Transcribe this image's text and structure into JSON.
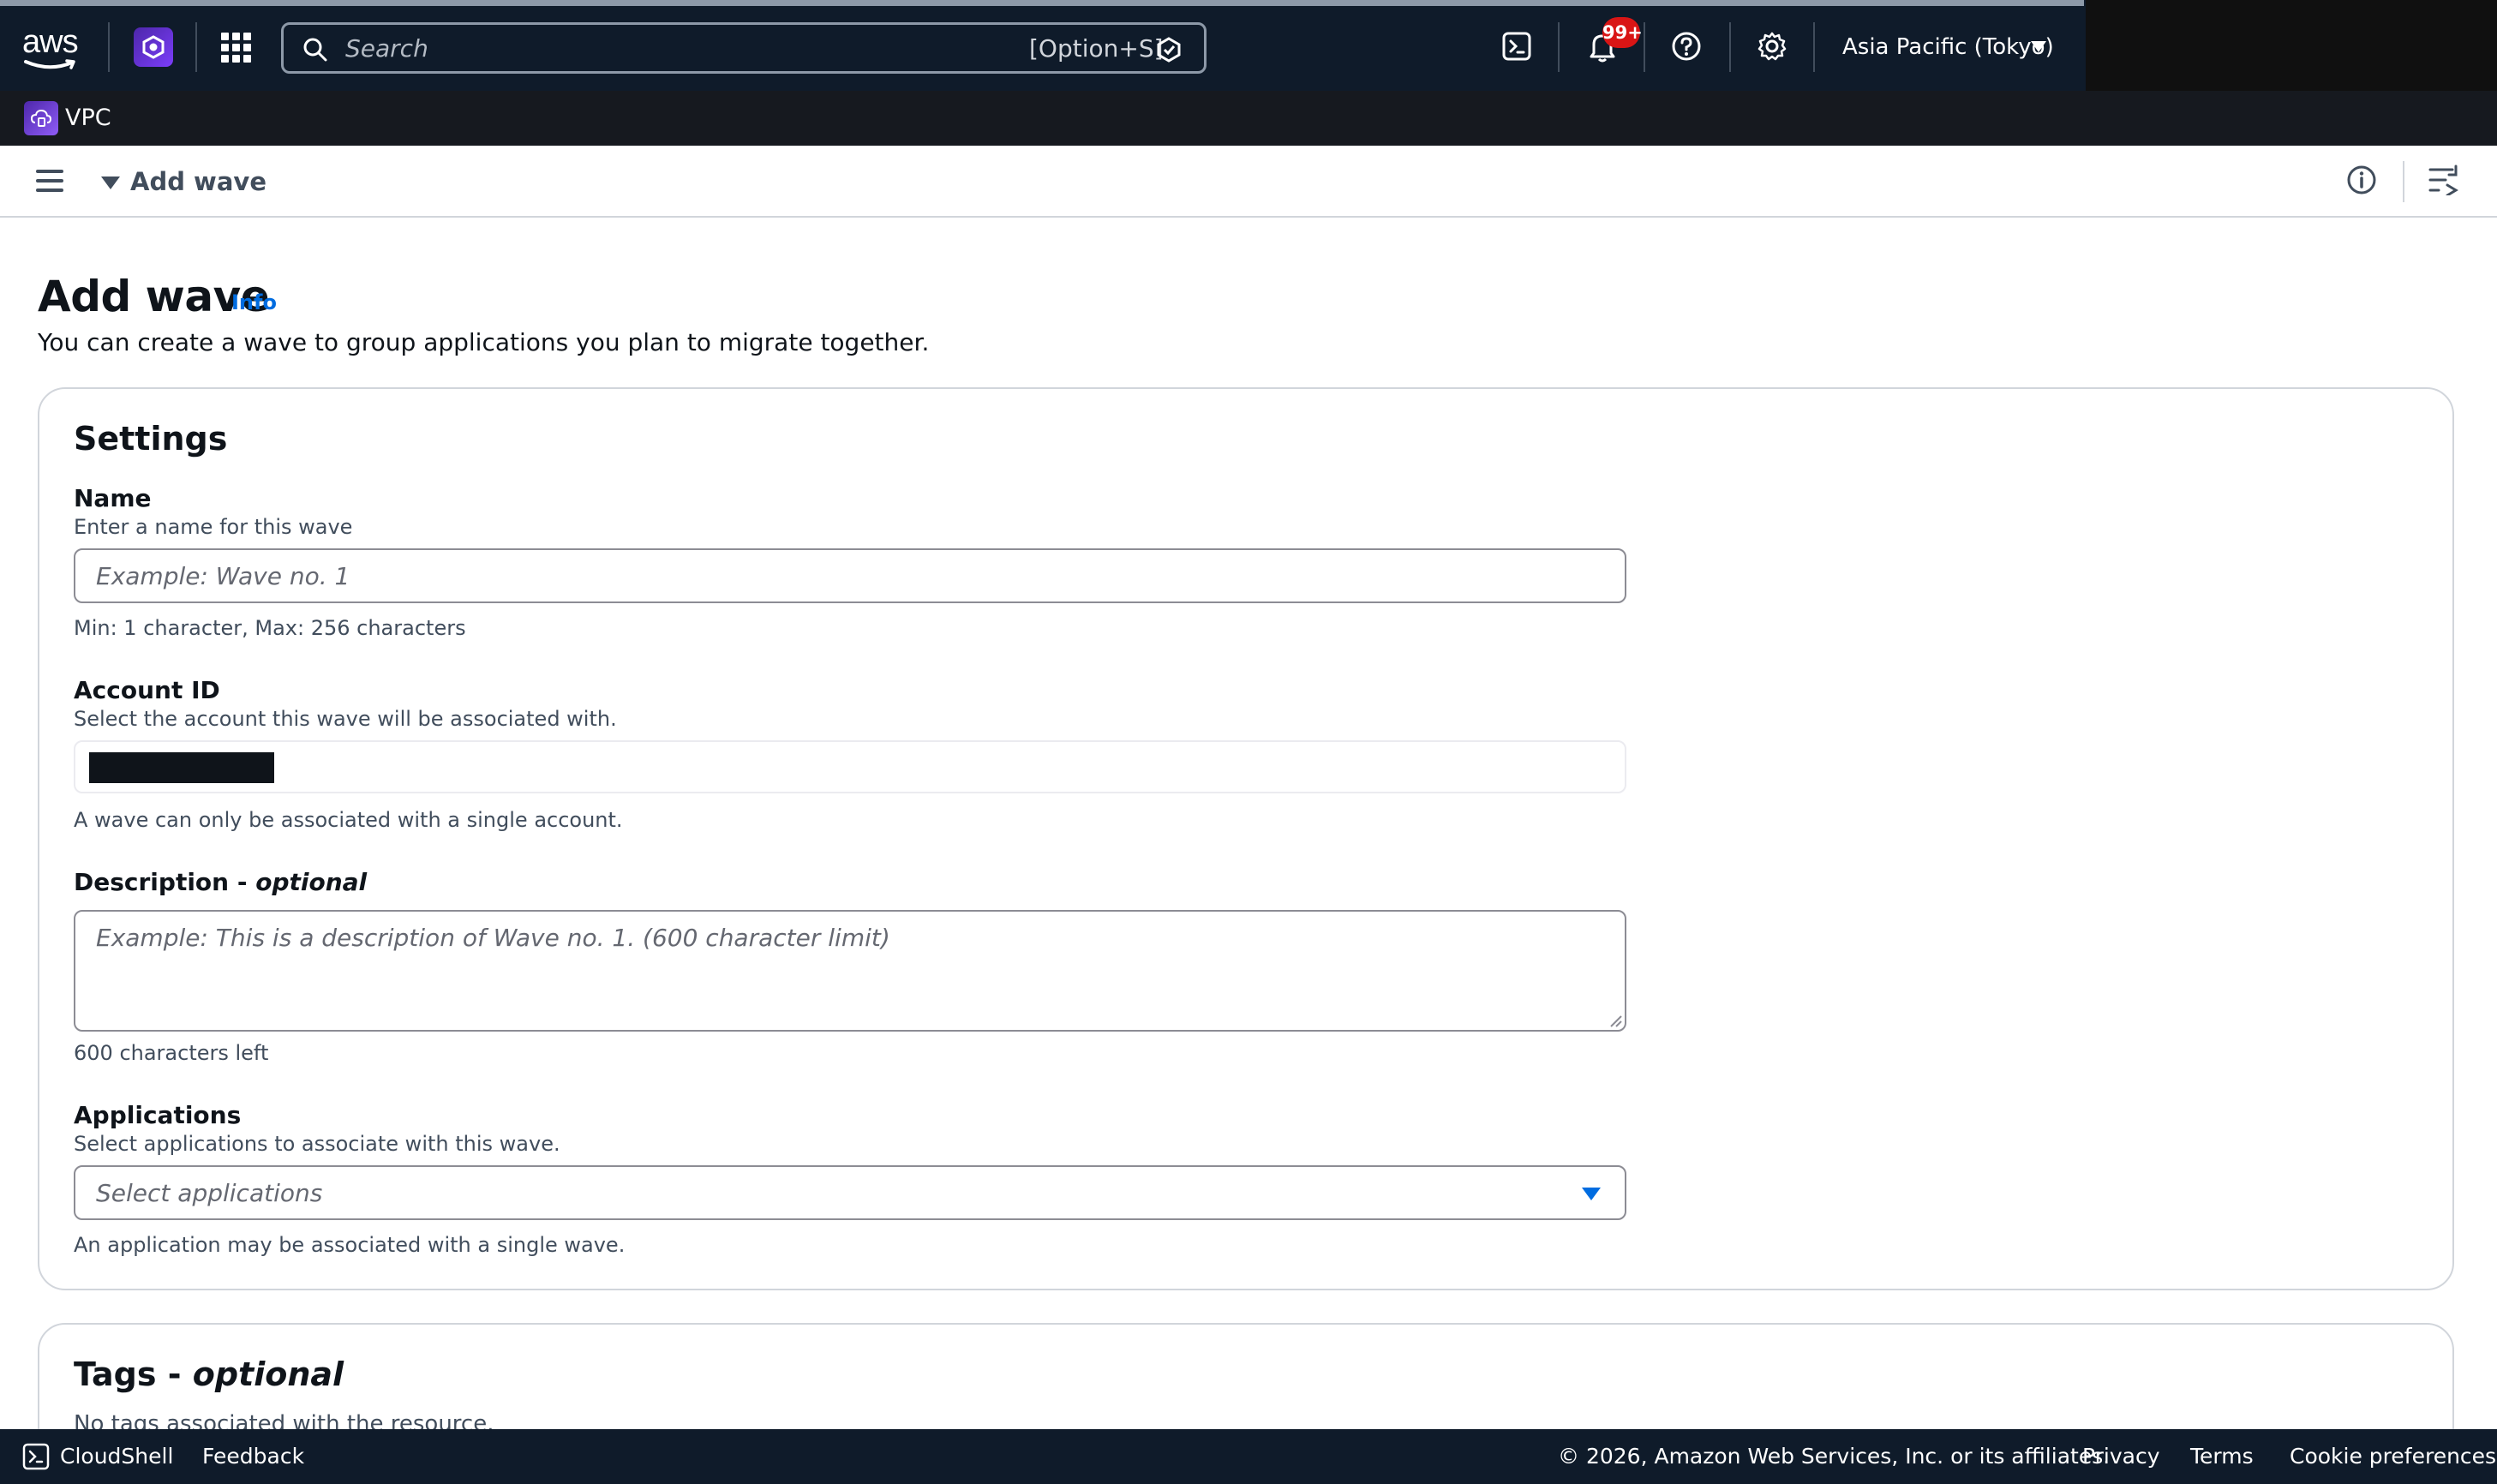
{
  "topnav": {
    "logo_text": "aws",
    "search_placeholder": "Search",
    "search_shortcut": "[Option+S]",
    "notification_badge": "99+",
    "region": "Asia Pacific (Tokyo)",
    "colors": {
      "background": "#0f1b2a",
      "badge": "#d91515"
    }
  },
  "service": {
    "name": "VPC"
  },
  "breadcrumb": {
    "current": "Add wave"
  },
  "page": {
    "title": "Add wave",
    "info_link": "Info",
    "description": "You can create a wave to group applications you plan to migrate together."
  },
  "settings": {
    "title": "Settings",
    "name": {
      "label": "Name",
      "hint": "Enter a name for this wave",
      "placeholder": "Example: Wave no. 1",
      "constraint": "Min: 1 character, Max: 256 characters"
    },
    "account": {
      "label": "Account ID",
      "hint": "Select the account this wave will be associated with.",
      "value_redacted": true,
      "constraint": "A wave can only be associated with a single account."
    },
    "description": {
      "label": "Description - ",
      "label_optional": "optional",
      "placeholder": "Example: This is a description of Wave no. 1. (600 character limit)",
      "counter": "600 characters left"
    },
    "applications": {
      "label": "Applications",
      "hint": "Select applications to associate with this wave.",
      "placeholder": "Select applications",
      "constraint": "An application may be associated with a single wave."
    }
  },
  "tags": {
    "title": "Tags - ",
    "title_optional": "optional",
    "empty_text": "No tags associated with the resource."
  },
  "footer": {
    "cloudshell": "CloudShell",
    "feedback": "Feedback",
    "copyright": "© 2026, Amazon Web Services, Inc. or its affiliates.",
    "privacy": "Privacy",
    "terms": "Terms",
    "cookie": "Cookie preferences"
  },
  "icons": [
    "aws-logo",
    "service-cube-icon",
    "apps-grid-icon",
    "search-icon",
    "q-icon",
    "cloudshell-icon",
    "bell-icon",
    "help-icon",
    "gear-icon",
    "caret-down-icon",
    "hamburger-icon",
    "info-icon",
    "split-panel-icon",
    "resize-grip-icon"
  ],
  "accent_color": "#006ce0"
}
